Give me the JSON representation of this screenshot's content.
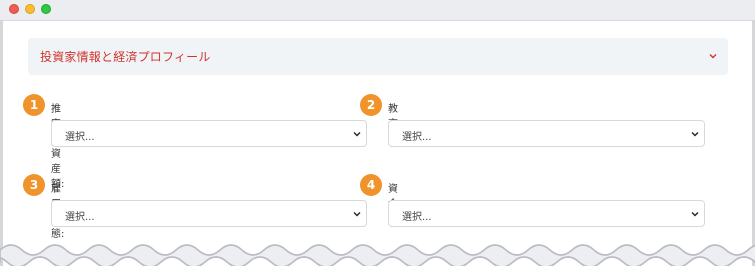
{
  "window": {
    "controls": [
      "close",
      "minimize",
      "maximize"
    ]
  },
  "accordion": {
    "title": "投資家情報と経済プロフィール",
    "icon": "chevron-down-icon",
    "expanded": true
  },
  "fields": [
    {
      "number": "1",
      "label": "推定純資産額:",
      "placeholder": "選択..."
    },
    {
      "number": "2",
      "label": "教育:",
      "placeholder": "選択..."
    },
    {
      "number": "3",
      "label": "雇用形態:",
      "placeholder": "選択..."
    },
    {
      "number": "4",
      "label": "資金源:",
      "placeholder": "選択..."
    }
  ],
  "colors": {
    "accent_text": "#d0342c",
    "badge": "#f0932b",
    "header_bg": "#f1f4f7"
  }
}
